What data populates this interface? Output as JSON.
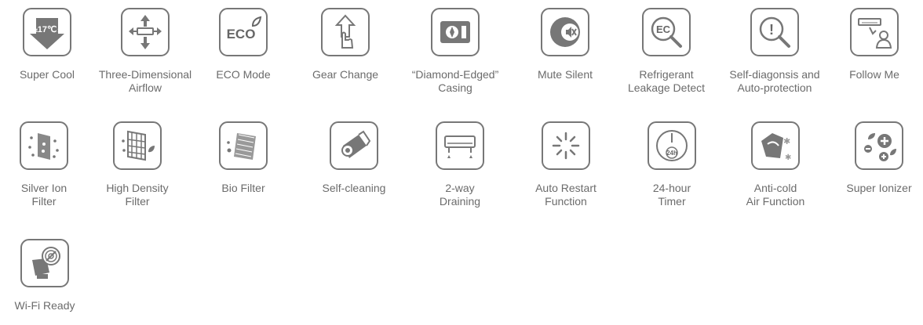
{
  "features": [
    {
      "icon": "super-cool-icon",
      "line1": "Super Cool",
      "line2": "",
      "tile_text": "17℃"
    },
    {
      "icon": "three-dimensional-airflow-icon",
      "line1": "Three-Dimensional",
      "line2": "Airflow"
    },
    {
      "icon": "eco-mode-icon",
      "line1": "ECO Mode",
      "line2": "",
      "tile_text": "ECO"
    },
    {
      "icon": "gear-change-icon",
      "line1": "Gear Change",
      "line2": ""
    },
    {
      "icon": "diamond-edged-casing-icon",
      "line1": "“Diamond-Edged”",
      "line2": "Casing"
    },
    {
      "icon": "mute-silent-icon",
      "line1": "Mute Silent",
      "line2": ""
    },
    {
      "icon": "refrigerant-leakage-detect-icon",
      "line1": "Refrigerant",
      "line2": "Leakage Detect",
      "tile_text": "EC"
    },
    {
      "icon": "self-diagnosis-icon",
      "line1": "Self-diagonsis and",
      "line2": "Auto-protection",
      "tile_text": "!"
    },
    {
      "icon": "follow-me-icon",
      "line1": "Follow Me",
      "line2": ""
    },
    {
      "icon": "silver-ion-filter-icon",
      "line1": "Silver Ion",
      "line2": "Filter"
    },
    {
      "icon": "high-density-filter-icon",
      "line1": "High Density",
      "line2": "Filter"
    },
    {
      "icon": "bio-filter-icon",
      "line1": "Bio Filter",
      "line2": ""
    },
    {
      "icon": "self-cleaning-icon",
      "line1": "Self-cleaning",
      "line2": ""
    },
    {
      "icon": "two-way-draining-icon",
      "line1": "2-way",
      "line2": "Draining"
    },
    {
      "icon": "auto-restart-icon",
      "line1": "Auto Restart",
      "line2": "Function"
    },
    {
      "icon": "timer-24h-icon",
      "line1": "24-hour",
      "line2": "Timer",
      "tile_text": "24h"
    },
    {
      "icon": "anti-cold-air-icon",
      "line1": "Anti-cold",
      "line2": "Air Function"
    },
    {
      "icon": "super-ionizer-icon",
      "line1": "Super Ionizer",
      "line2": ""
    },
    {
      "icon": "wifi-ready-icon",
      "line1": "Wi-Fi Ready",
      "line2": ""
    }
  ]
}
